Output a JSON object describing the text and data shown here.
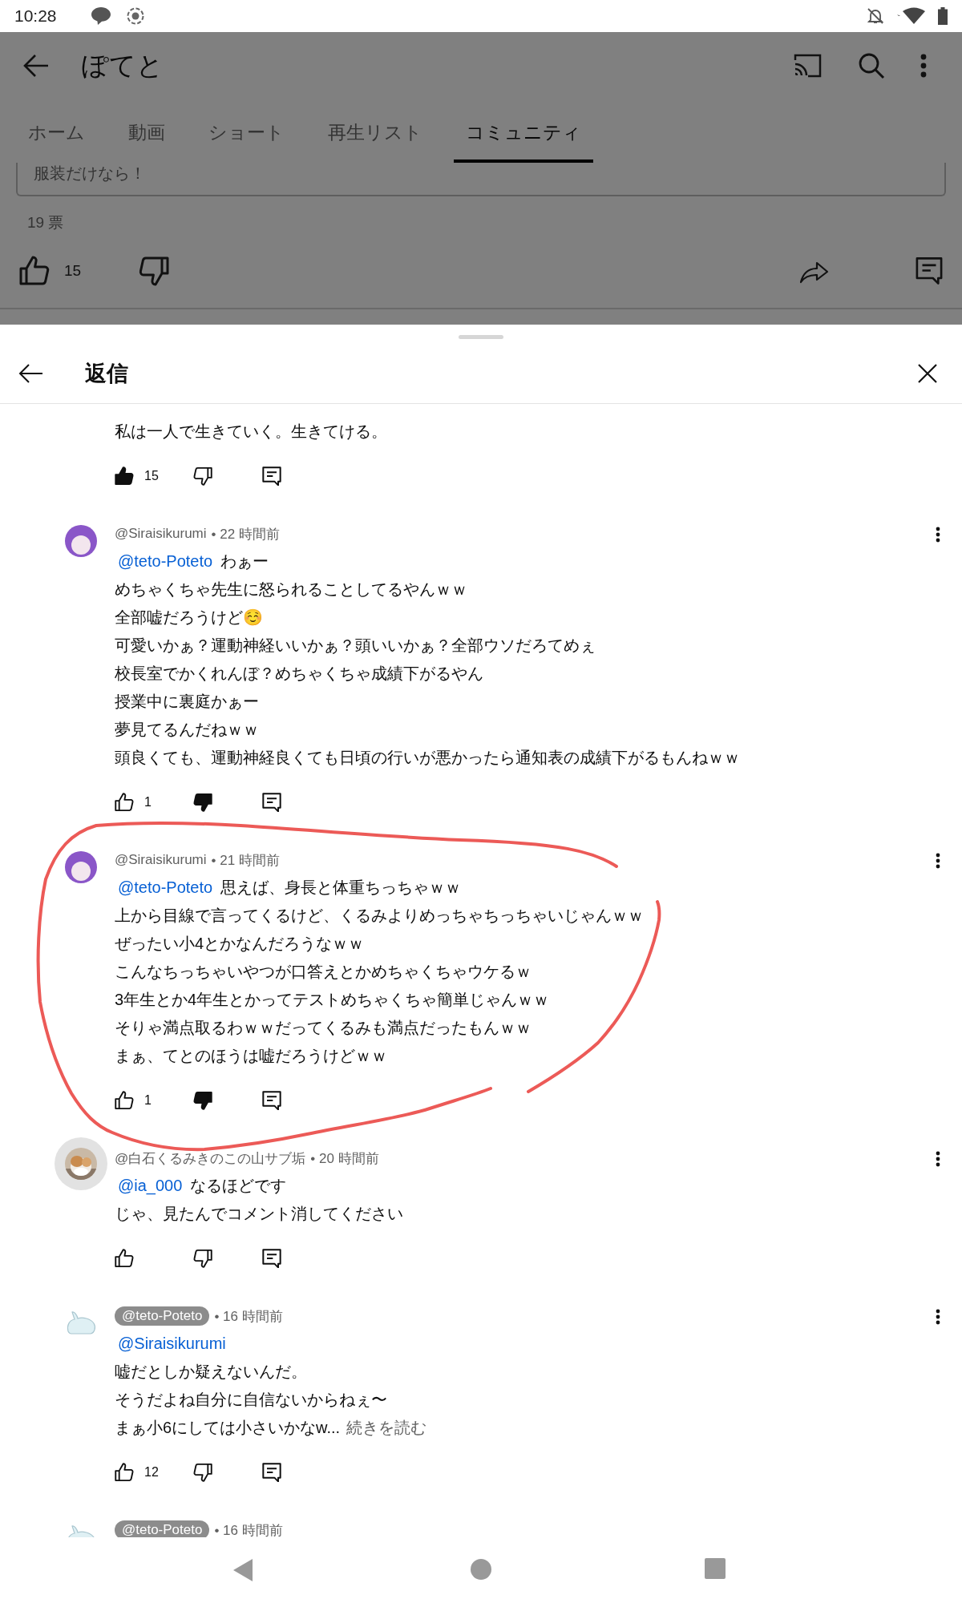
{
  "status_bar": {
    "time": "10:28"
  },
  "channel_header": {
    "title": "ぽてと"
  },
  "tabs": [
    {
      "label": "ホーム",
      "selected": false
    },
    {
      "label": "動画",
      "selected": false
    },
    {
      "label": "ショート",
      "selected": false
    },
    {
      "label": "再生リスト",
      "selected": false
    },
    {
      "label": "コミュニティ",
      "selected": true
    }
  ],
  "poll": {
    "option": "服装だけなら！",
    "votes": "19 票",
    "likes": "15"
  },
  "replies_sheet": {
    "title": "返信"
  },
  "comments": [
    {
      "kind": "continued",
      "lines": [
        "私は一人で生きていく。生きてける。"
      ],
      "likes": "15",
      "liked": true,
      "disliked": false
    },
    {
      "kind": "reply",
      "avatar": {
        "kind": "character"
      },
      "author": "@Siraisikurumi",
      "author_badge": false,
      "time": "• 22 時間前",
      "mention": "@teto-Poteto",
      "mention_text": "わぁー",
      "lines": [
        "めちゃくちゃ先生に怒られることしてるやんｗｗ",
        "全部嘘だろうけど☺️",
        "可愛いかぁ？運動神経いいかぁ？頭いいかぁ？全部ウソだろてめぇ",
        "校長室でかくれんぼ？めちゃくちゃ成績下がるやん",
        "授業中に裏庭かぁー",
        "夢見てるんだねｗｗ",
        "頭良くても、運動神経良くても日頃の行いが悪かったら通知表の成績下がるもんねｗｗ"
      ],
      "likes": "1",
      "liked": false,
      "disliked": true
    },
    {
      "kind": "reply",
      "avatar": {
        "kind": "character"
      },
      "author": "@Siraisikurumi",
      "author_badge": false,
      "time": "• 21 時間前",
      "mention": "@teto-Poteto",
      "mention_text": "思えば、身長と体重ちっちゃｗｗ",
      "lines": [
        "上から目線で言ってくるけど、くるみよりめっちゃちっちゃいじゃんｗｗ",
        "ぜったい小4とかなんだろうなｗｗ",
        "こんなちっちゃいやつが口答えとかめちゃくちゃウケるｗ",
        "3年生とか4年生とかってテストめちゃくちゃ簡単じゃんｗｗ",
        "そりゃ満点取るわｗｗだってくるみも満点だったもんｗｗ",
        "まぁ、てとのほうは嘘だろうけどｗｗ"
      ],
      "likes": "1",
      "liked": false,
      "disliked": true
    },
    {
      "kind": "reply",
      "author": "@白石くるみきのこの山サブ垢",
      "author_badge": false,
      "time": "• 20 時間前",
      "mention": "@ia_000",
      "mention_text": "なるほどです",
      "lines": [
        "じゃ、見たんでコメント消してください"
      ],
      "liked": false,
      "disliked": false
    },
    {
      "kind": "reply",
      "avatar": {
        "kind": "creature"
      },
      "author": "@teto-Poteto",
      "author_badge": true,
      "time": "• 16 時間前",
      "mention": "@Siraisikurumi",
      "lines": [
        "嘘だとしか疑えないんだ。",
        "そうだよね自分に自信ないからねぇ〜",
        "まぁ小6にしては小さいかなw..."
      ],
      "more": "続きを読む",
      "likes": "12",
      "liked": false,
      "disliked": false
    },
    {
      "kind": "partial",
      "avatar": {
        "kind": "creature"
      },
      "author": "@teto-Poteto",
      "author_badge": true,
      "time": "• 16 時間前"
    }
  ],
  "annotation": {
    "kind": "loop"
  }
}
